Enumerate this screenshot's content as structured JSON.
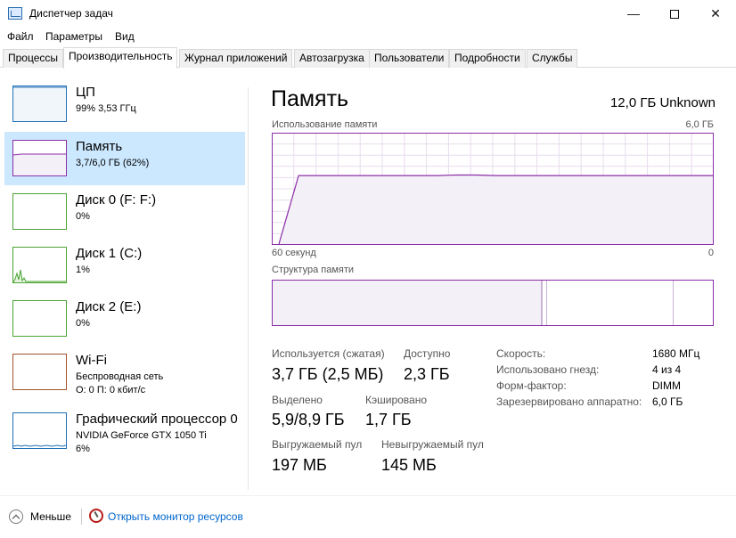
{
  "window": {
    "title": "Диспетчер задач",
    "minimize": "—",
    "close": "✕"
  },
  "menu": [
    "Файл",
    "Параметры",
    "Вид"
  ],
  "tabs": [
    "Процессы",
    "Производительность",
    "Журнал приложений",
    "Автозагрузка",
    "Пользователи",
    "Подробности",
    "Службы"
  ],
  "active_tab": "Производительность",
  "resources": [
    {
      "name": "ЦП",
      "sub": "99% 3,53 ГГц",
      "sub2": "",
      "color": "#1f6fb5"
    },
    {
      "name": "Память",
      "sub": "3,7/6,0 ГБ (62%)",
      "sub2": "",
      "color": "#8b2da8",
      "selected": true
    },
    {
      "name": "Диск 0 (F: F:)",
      "sub": "0%",
      "sub2": "",
      "color": "#4aa432"
    },
    {
      "name": "Диск 1 (C:)",
      "sub": "1%",
      "sub2": "",
      "color": "#4aa432"
    },
    {
      "name": "Диск 2 (E:)",
      "sub": "0%",
      "sub2": "",
      "color": "#4aa432"
    },
    {
      "name": "Wi-Fi",
      "sub": "Беспроводная сеть",
      "sub2": "О: 0 П: 0 кбит/с",
      "color": "#a0522d"
    },
    {
      "name": "Графический процессор 0",
      "sub": "NVIDIA GeForce GTX 1050 Ti",
      "sub2": "6%",
      "color": "#1f6fb5"
    }
  ],
  "memory": {
    "title": "Память",
    "total": "12,0 ГБ Unknown",
    "usage_label": "Использование памяти",
    "usage_max": "6,0 ГБ",
    "time_left": "60 секунд",
    "time_right": "0",
    "structure_label": "Структура памяти",
    "usage_history_fraction": [
      0.0,
      0.62,
      0.62,
      0.62,
      0.62,
      0.62,
      0.62,
      0.62,
      0.62,
      0.625,
      0.625,
      0.62,
      0.62,
      0.62,
      0.62,
      0.62,
      0.62,
      0.62,
      0.62,
      0.62,
      0.62,
      0.62,
      0.62
    ],
    "stats": {
      "in_use_label": "Используется (сжатая)",
      "in_use_value": "3,7 ГБ (2,5 МБ)",
      "available_label": "Доступно",
      "available_value": "2,3 ГБ",
      "committed_label": "Выделено",
      "committed_value": "5,9/8,9 ГБ",
      "cached_label": "Кэшировано",
      "cached_value": "1,7 ГБ",
      "paged_label": "Выгружаемый пул",
      "paged_value": "197 МБ",
      "nonpaged_label": "Невыгружаемый пул",
      "nonpaged_value": "145 МБ"
    },
    "details": [
      {
        "label": "Скорость:",
        "value": "1680 МГц"
      },
      {
        "label": "Использовано гнезд:",
        "value": "4 из 4"
      },
      {
        "label": "Форм-фактор:",
        "value": "DIMM"
      },
      {
        "label": "Зарезервировано аппаратно:",
        "value": "6,0 ГБ"
      }
    ]
  },
  "footer": {
    "less": "Меньше",
    "resource_monitor": "Открыть монитор ресурсов"
  },
  "colors": {
    "memory": "#8b2da8",
    "memory_fill": "#f4f0f7",
    "selection": "#cce8ff",
    "link": "#0066cc"
  }
}
